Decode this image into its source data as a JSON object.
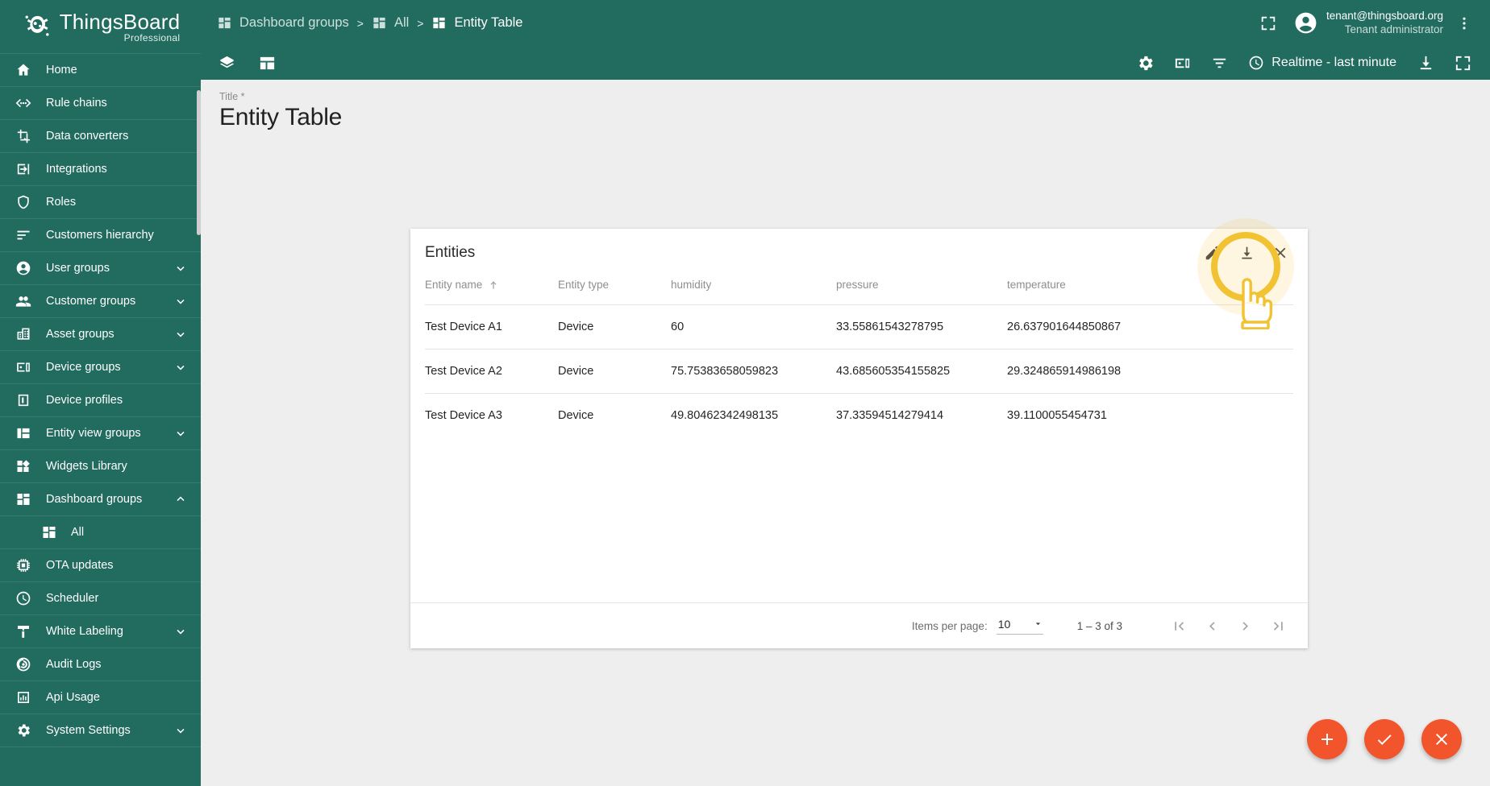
{
  "brand": {
    "name": "ThingsBoard",
    "edition": "Professional",
    "logo_icon": "thingsboard-logo-icon",
    "accent_green": "#216b5f",
    "accent_orange": "#f2552c",
    "highlight_yellow": "#f1c232"
  },
  "sidebar": {
    "items": [
      {
        "label": "Home",
        "icon": "home-icon",
        "expandable": false,
        "sub": false
      },
      {
        "label": "Rule chains",
        "icon": "rule-chains-icon",
        "expandable": false,
        "sub": false
      },
      {
        "label": "Data converters",
        "icon": "data-converters-icon",
        "expandable": false,
        "sub": false
      },
      {
        "label": "Integrations",
        "icon": "integrations-icon",
        "expandable": false,
        "sub": false
      },
      {
        "label": "Roles",
        "icon": "shield-icon",
        "expandable": false,
        "sub": false
      },
      {
        "label": "Customers hierarchy",
        "icon": "hierarchy-icon",
        "expandable": false,
        "sub": false
      },
      {
        "label": "User groups",
        "icon": "account-circle-icon",
        "expandable": true,
        "expanded": false,
        "sub": false
      },
      {
        "label": "Customer groups",
        "icon": "people-icon",
        "expandable": true,
        "expanded": false,
        "sub": false
      },
      {
        "label": "Asset groups",
        "icon": "domain-icon",
        "expandable": true,
        "expanded": false,
        "sub": false
      },
      {
        "label": "Device groups",
        "icon": "devices-icon",
        "expandable": true,
        "expanded": false,
        "sub": false
      },
      {
        "label": "Device profiles",
        "icon": "device-profile-icon",
        "expandable": false,
        "sub": false
      },
      {
        "label": "Entity view groups",
        "icon": "entity-view-icon",
        "expandable": true,
        "expanded": false,
        "sub": false
      },
      {
        "label": "Widgets Library",
        "icon": "widgets-icon",
        "expandable": false,
        "sub": false
      },
      {
        "label": "Dashboard groups",
        "icon": "dashboards-icon",
        "expandable": true,
        "expanded": true,
        "sub": false
      },
      {
        "label": "All",
        "icon": "dashboards-icon",
        "expandable": false,
        "sub": true
      },
      {
        "label": "OTA updates",
        "icon": "memory-icon",
        "expandable": false,
        "sub": false
      },
      {
        "label": "Scheduler",
        "icon": "clock-icon",
        "expandable": false,
        "sub": false
      },
      {
        "label": "White Labeling",
        "icon": "brush-icon",
        "expandable": true,
        "expanded": false,
        "sub": false
      },
      {
        "label": "Audit Logs",
        "icon": "audit-track-icon",
        "expandable": false,
        "sub": false
      },
      {
        "label": "Api Usage",
        "icon": "bar-chart-icon",
        "expandable": false,
        "sub": false
      },
      {
        "label": "System Settings",
        "icon": "gear-icon",
        "expandable": true,
        "expanded": false,
        "sub": false
      }
    ]
  },
  "topbar": {
    "breadcrumbs": [
      {
        "label": "Dashboard groups",
        "icon": "dashboards-icon",
        "active": false
      },
      {
        "label": "All",
        "icon": "dashboards-icon",
        "active": false
      },
      {
        "label": "Entity Table",
        "icon": "dashboards-icon",
        "active": true
      }
    ],
    "separator": ">",
    "fullscreen_icon": "fullscreen-icon",
    "user": {
      "email": "tenant@thingsboard.org",
      "role": "Tenant administrator",
      "avatar_icon": "account-circle-icon"
    },
    "more_icon": "more-vert-icon"
  },
  "toolbar": {
    "left_buttons": [
      {
        "name": "layers-button",
        "icon": "layers-icon"
      },
      {
        "name": "dashboard-states-button",
        "icon": "dashboard-layout-icon"
      }
    ],
    "right_buttons": [
      {
        "name": "settings-button",
        "icon": "gear-icon"
      },
      {
        "name": "manage-devices-button",
        "icon": "devices-icon"
      },
      {
        "name": "filters-button",
        "icon": "filter-icon"
      }
    ],
    "timewindow": {
      "label": "Realtime - last minute",
      "icon": "clock-icon"
    },
    "trailing_buttons": [
      {
        "name": "download-button",
        "icon": "download-icon"
      },
      {
        "name": "fullscreen-button",
        "icon": "fullscreen-icon"
      }
    ]
  },
  "page": {
    "title_label": "Title *",
    "title_value": "Entity Table"
  },
  "widget": {
    "title": "Entities",
    "actions": [
      {
        "name": "edit-widget-button",
        "icon": "pencil-icon",
        "highlighted": true
      },
      {
        "name": "export-widget-button",
        "icon": "download-icon",
        "highlighted": false
      },
      {
        "name": "remove-widget-button",
        "icon": "close-icon",
        "highlighted": false
      }
    ],
    "table": {
      "columns": [
        {
          "label": "Entity name",
          "sorted": true,
          "sort_dir": "asc",
          "sort_icon": "arrow-up-icon"
        },
        {
          "label": "Entity type",
          "sorted": false
        },
        {
          "label": "humidity",
          "sorted": false
        },
        {
          "label": "pressure",
          "sorted": false
        },
        {
          "label": "temperature",
          "sorted": false
        }
      ],
      "rows": [
        [
          "Test Device A1",
          "Device",
          "60",
          "33.55861543278795",
          "26.637901644850867"
        ],
        [
          "Test Device A2",
          "Device",
          "75.75383658059823",
          "43.685605354155825",
          "29.324865914986198"
        ],
        [
          "Test Device A3",
          "Device",
          "49.80462342498135",
          "37.33594514279414",
          "39.1100055454731"
        ]
      ]
    },
    "paginator": {
      "items_per_page_label": "Items per page:",
      "items_per_page_value": "10",
      "range_label": "1 – 3 of 3",
      "buttons": [
        {
          "name": "first-page-button",
          "icon": "first-page-icon"
        },
        {
          "name": "previous-page-button",
          "icon": "chevron-left-icon"
        },
        {
          "name": "next-page-button",
          "icon": "chevron-right-icon"
        },
        {
          "name": "last-page-button",
          "icon": "last-page-icon"
        }
      ]
    }
  },
  "fabs": [
    {
      "name": "add-widget-fab",
      "icon": "plus-icon"
    },
    {
      "name": "apply-changes-fab",
      "icon": "check-icon"
    },
    {
      "name": "cancel-changes-fab",
      "icon": "close-icon"
    }
  ],
  "cursor": {
    "icon": "pointing-hand-cursor",
    "target": "edit-widget-button"
  }
}
